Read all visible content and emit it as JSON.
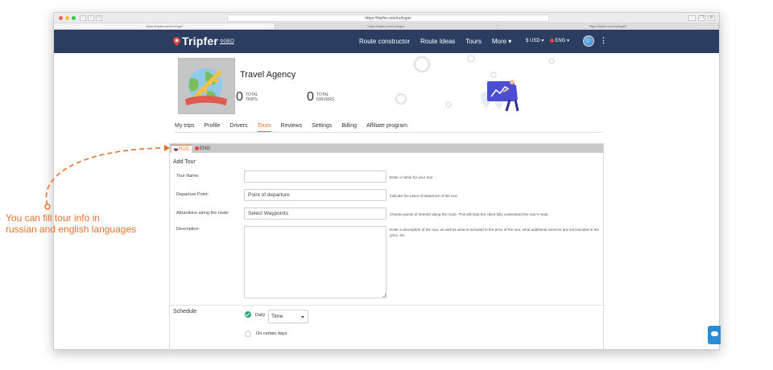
{
  "browser": {
    "url": "https://tripfer.com/ru/login/",
    "tabs": [
      "https://tripfer.com/ru/login/",
      "https://tripfer.com/ru/login/",
      "https://tripfer.com/ru/login/"
    ]
  },
  "nav": {
    "logo": "Tripfer",
    "geo": "GEO",
    "links": [
      "Route constructor",
      "Route Ideas",
      "Tours",
      "More ▾"
    ],
    "currency": "$ USD ▾",
    "language": "ENG ▾",
    "menu_glyph": "⋮"
  },
  "profile": {
    "name": "Travel Agency",
    "stats": [
      {
        "value": "0",
        "label1": "TOTAL",
        "label2": "TRIPS"
      },
      {
        "value": "0",
        "label1": "TOTAL",
        "label2": "DRIVERS"
      }
    ],
    "tabs": [
      "My trips",
      "Profile",
      "Drivers",
      "Tours",
      "Reviews",
      "Settings",
      "Billing",
      "Affiliate program"
    ],
    "active_tab": "Tours"
  },
  "form": {
    "lang_tabs": [
      "RUS",
      "ENG"
    ],
    "title": "Add Tour",
    "fields": [
      {
        "label": "Tour Name:",
        "value": "",
        "hint": "Enter a name for your tour"
      },
      {
        "label": "Departure Point:",
        "value": "Point of departure",
        "hint": "Indicate the place of departure of the tour"
      },
      {
        "label": "Attractions along the route:",
        "value": "Select Waypoints",
        "hint": "Choose points of interest along the route. This will help the client fully understand the tour's route"
      },
      {
        "label": "Description:",
        "value": "",
        "hint": "Enter a description of the tour, as well as what is included in the price of the tour, what additional services are not included in the price, etc."
      }
    ],
    "schedule": {
      "label": "Schedule",
      "daily_label": "Daily",
      "time_value": "Time",
      "certain_days_label": "On certain days"
    }
  },
  "annotation": {
    "line1": "You can fill tour info in",
    "line2": "russian and english languages"
  },
  "colors": {
    "nav_bg": "#2c3d62",
    "accent": "#e8702a",
    "radio_on": "#2aa775",
    "chat": "#2a8bd8"
  }
}
